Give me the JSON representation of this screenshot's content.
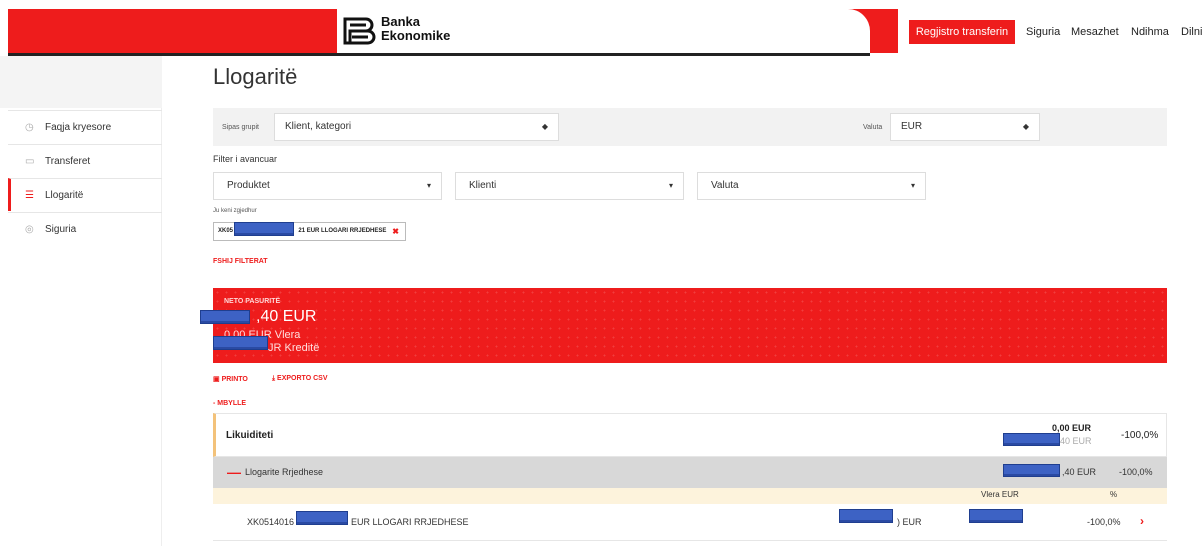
{
  "header": {
    "brand_line1": "Banka",
    "brand_line2": "Ekonomike",
    "register_button": "Regjistro transferin",
    "nav": [
      "Siguria",
      "Mesazhet",
      "Ndihma",
      "Dilni"
    ]
  },
  "sidebar": {
    "items": [
      {
        "label": "Faqja kryesore",
        "icon": "home-icon"
      },
      {
        "label": "Transferet",
        "icon": "card-icon"
      },
      {
        "label": "Llogaritë",
        "icon": "database-icon"
      },
      {
        "label": "Siguria",
        "icon": "shield-icon"
      }
    ]
  },
  "main": {
    "title": "Llogaritë",
    "group_label": "Sipas grupit",
    "group_value": "Klient, kategori",
    "currency_label": "Valuta",
    "currency_value": "EUR",
    "advanced_label": "Filter i avancuar",
    "filters": [
      "Produktet",
      "Klienti",
      "Valuta"
    ],
    "chosen_label": "Ju keni zgjedhur",
    "chosen_chip_prefix": "XK05",
    "chosen_chip_suffix": "21 EUR LLOGARI RRJEDHESE",
    "clear_filters": "FSHIJ FILTERAT"
  },
  "net": {
    "title": "NETO PASURITË",
    "main_value": ",40 EUR",
    "line2": "0,00 EUR Vlera",
    "line3": "JR Kreditë"
  },
  "actions": {
    "print": "PRINTO",
    "export": "EXPORTO CSV",
    "collapse": "- MBYLLE"
  },
  "table": {
    "liquidity": {
      "name": "Likuiditeti",
      "value1": "0,00 EUR",
      "value2": "40 EUR",
      "pct": "-100,0%"
    },
    "group": {
      "name": "Llogarite Rrjedhese",
      "value": ",40 EUR",
      "pct": "-100,0%"
    },
    "header": {
      "col1": "Vlera EUR",
      "col2": "%"
    },
    "account": {
      "iban": "XK0514016",
      "desc": "EUR LLOGARI RRJEDHESE",
      "value": ") EUR",
      "pct": "-100,0%"
    }
  },
  "colors": {
    "accent": "#ee1c1c",
    "redaction": "#3d62c4"
  }
}
